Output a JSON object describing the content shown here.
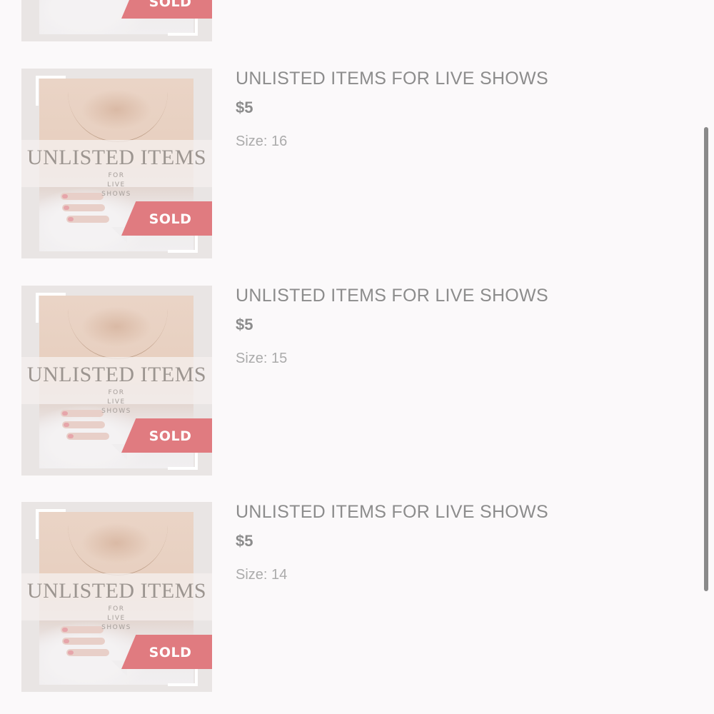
{
  "products": [
    {
      "name": "UNLISTED ITEMS FOR LIVE SHOWS",
      "price": "$5",
      "size": "Size: 16",
      "image": {
        "title": "UNLISTED ITEMS",
        "subtitle": "FOR LIVE SHOWS",
        "badge": "SOLD"
      }
    },
    {
      "name": "UNLISTED ITEMS FOR LIVE SHOWS",
      "price": "$5",
      "size": "Size: 15",
      "image": {
        "title": "UNLISTED ITEMS",
        "subtitle": "FOR LIVE SHOWS",
        "badge": "SOLD"
      }
    },
    {
      "name": "UNLISTED ITEMS FOR LIVE SHOWS",
      "price": "$5",
      "size": "Size: 14",
      "image": {
        "title": "UNLISTED ITEMS",
        "subtitle": "FOR LIVE SHOWS",
        "badge": "SOLD"
      }
    }
  ],
  "partial_top_product": {
    "image": {
      "badge": "SOLD"
    }
  },
  "colors": {
    "background": "#fbf9fa",
    "sold_badge": "#e07b80",
    "text_primary": "#8c8c8c",
    "text_secondary": "#ababab",
    "scrollbar": "#8a8a8a"
  }
}
